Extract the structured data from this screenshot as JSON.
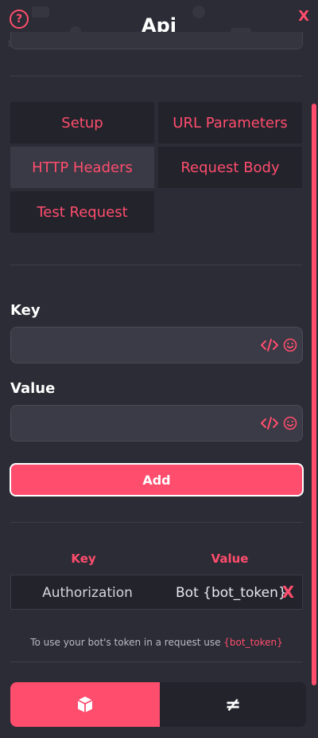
{
  "header": {
    "title": "Api",
    "help_icon": "question-circle-icon",
    "close_label": "X"
  },
  "tabs": [
    {
      "label": "Setup",
      "active": false
    },
    {
      "label": "URL Parameters",
      "active": false
    },
    {
      "label": "HTTP Headers",
      "active": true
    },
    {
      "label": "Request Body",
      "active": false
    },
    {
      "label": "Test Request",
      "active": false
    }
  ],
  "form": {
    "key_label": "Key",
    "key_value": "",
    "value_label": "Value",
    "value_value": "",
    "add_label": "Add"
  },
  "headers_table": {
    "columns": [
      "Key",
      "Value"
    ],
    "rows": [
      {
        "key": "Authorization",
        "value": "Bot {bot_token}",
        "delete_label": "X"
      }
    ]
  },
  "tip": {
    "text": "To use your bot's token in a request use ",
    "token": "{bot_token}"
  },
  "bottom_nav": [
    {
      "icon": "cube-icon",
      "active": true
    },
    {
      "label": "≠",
      "icon": "not-equal-icon",
      "active": false
    }
  ],
  "colors": {
    "accent": "#ff4d6d",
    "background": "#2b2c35",
    "tab_bg": "#22232b",
    "tab_active_bg": "#393a45"
  }
}
